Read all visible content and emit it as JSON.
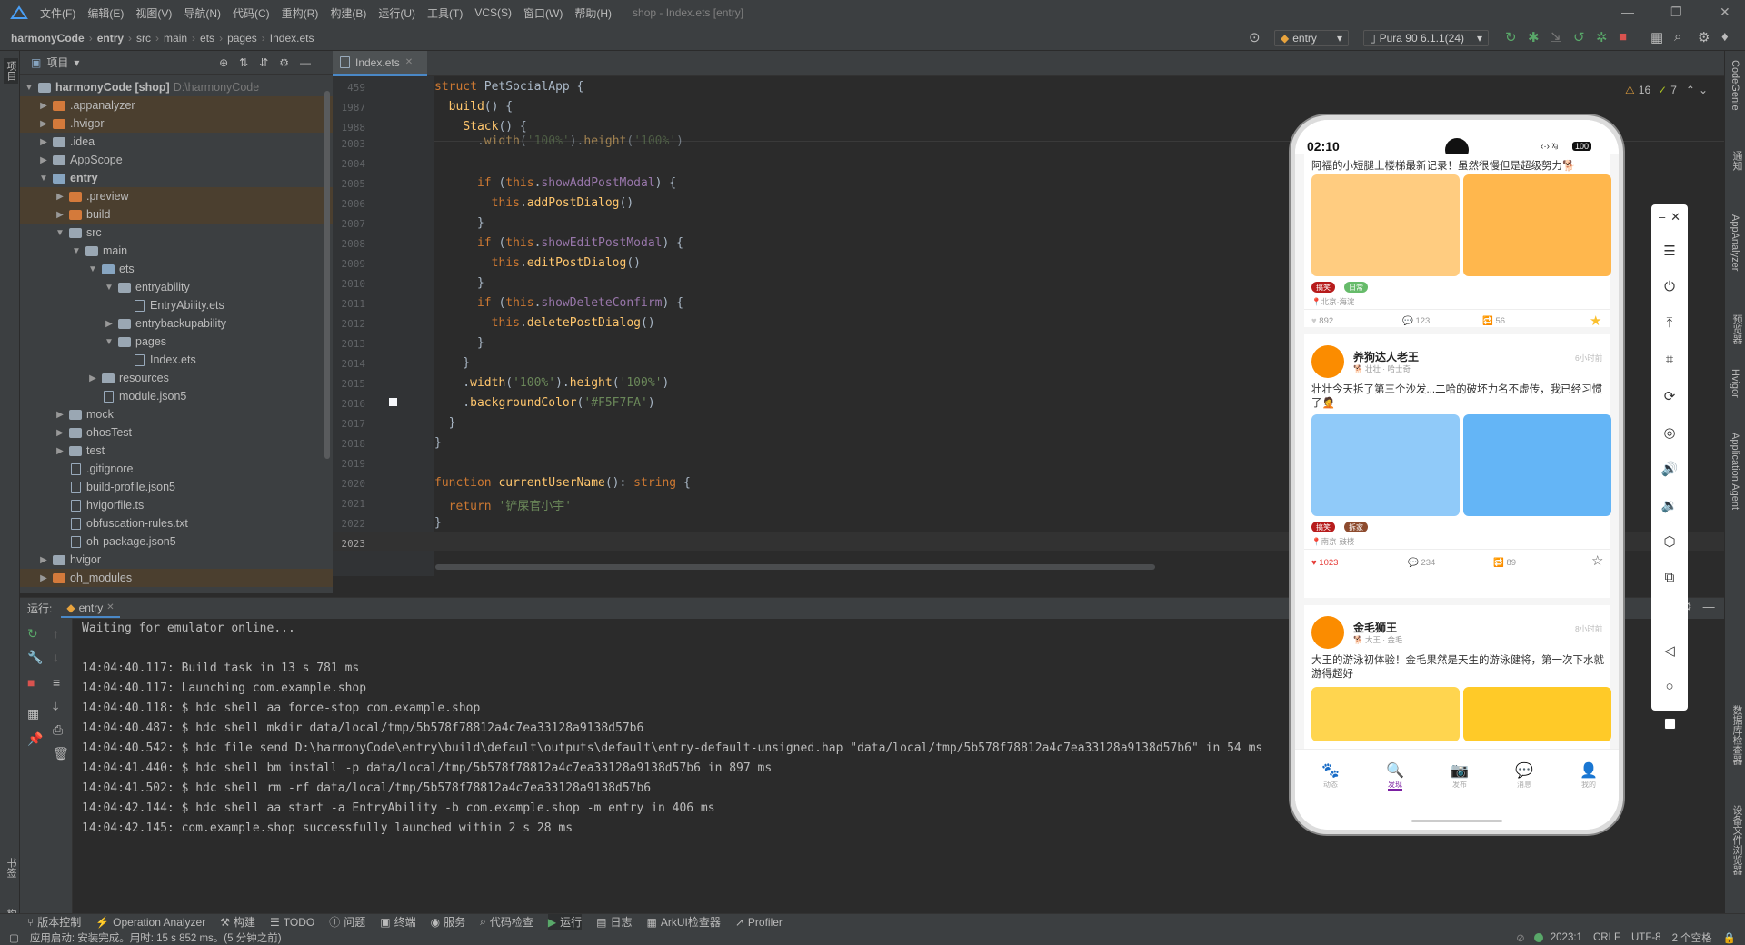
{
  "menu": {
    "items": [
      "文件(F)",
      "编辑(E)",
      "视图(V)",
      "导航(N)",
      "代码(C)",
      "重构(R)",
      "构建(B)",
      "运行(U)",
      "工具(T)",
      "VCS(S)",
      "窗口(W)",
      "帮助(H)"
    ],
    "window_title": "shop - Index.ets [entry]"
  },
  "breadcrumb": [
    "harmonyCode",
    "entry",
    "src",
    "main",
    "ets",
    "pages",
    "Index.ets"
  ],
  "toolbar": {
    "config": "entry",
    "device": "Pura 90 6.1.1(24)"
  },
  "project": {
    "title": "项目",
    "side_label": "项目",
    "rows": [
      {
        "label": "harmonyCode [shop]",
        "extra": "D:\\harmonyCode"
      },
      {
        "label": ".appanalyzer"
      },
      {
        "label": ".hvigor"
      },
      {
        "label": ".idea"
      },
      {
        "label": "AppScope"
      },
      {
        "label": "entry"
      },
      {
        "label": ".preview"
      },
      {
        "label": "build"
      },
      {
        "label": "src"
      },
      {
        "label": "main"
      },
      {
        "label": "ets"
      },
      {
        "label": "entryability"
      },
      {
        "label": "EntryAbility.ets"
      },
      {
        "label": "entrybackupability"
      },
      {
        "label": "pages"
      },
      {
        "label": "Index.ets"
      },
      {
        "label": "resources"
      },
      {
        "label": "module.json5"
      },
      {
        "label": "mock"
      },
      {
        "label": "ohosTest"
      },
      {
        "label": "test"
      },
      {
        "label": ".gitignore"
      },
      {
        "label": "build-profile.json5"
      },
      {
        "label": "hvigorfile.ts"
      },
      {
        "label": "obfuscation-rules.txt"
      },
      {
        "label": "oh-package.json5"
      },
      {
        "label": "hvigor"
      },
      {
        "label": "oh_modules"
      }
    ]
  },
  "editor": {
    "tab": "Index.ets",
    "warnings": "16",
    "weak_warnings": "7",
    "sticky": [
      {
        "num": "459",
        "code": "struct PetSocialApp {"
      },
      {
        "num": "1987",
        "code": "  build() {"
      },
      {
        "num": "1988",
        "code": "    Stack() {"
      }
    ],
    "lines": [
      {
        "num": "2003",
        "code": "      .width('100%').height('100%')"
      },
      {
        "num": "2004",
        "code": ""
      },
      {
        "num": "2005",
        "code": "      if (this.showAddPostModal) {"
      },
      {
        "num": "2006",
        "code": "        this.addPostDialog()"
      },
      {
        "num": "2007",
        "code": "      }"
      },
      {
        "num": "2008",
        "code": "      if (this.showEditPostModal) {"
      },
      {
        "num": "2009",
        "code": "        this.editPostDialog()"
      },
      {
        "num": "2010",
        "code": "      }"
      },
      {
        "num": "2011",
        "code": "      if (this.showDeleteConfirm) {"
      },
      {
        "num": "2012",
        "code": "        this.deletePostDialog()"
      },
      {
        "num": "2013",
        "code": "      }"
      },
      {
        "num": "2014",
        "code": "    }"
      },
      {
        "num": "2015",
        "code": "    .width('100%').height('100%')"
      },
      {
        "num": "2016",
        "code": "    .backgroundColor('#F5F7FA')"
      },
      {
        "num": "2017",
        "code": "  }"
      },
      {
        "num": "2018",
        "code": "}"
      },
      {
        "num": "2019",
        "code": ""
      },
      {
        "num": "2020",
        "code": "function currentUserName(): string {"
      },
      {
        "num": "2021",
        "code": "  return '铲屎官小宇'"
      },
      {
        "num": "2022",
        "code": "}"
      },
      {
        "num": "2023",
        "code": ""
      }
    ]
  },
  "run": {
    "label": "运行:",
    "tab": "entry",
    "lines": [
      "Waiting for emulator online...",
      "",
      "14:04:40.117: Build task in 13 s 781 ms",
      "14:04:40.117: Launching com.example.shop",
      "14:04:40.118: $ hdc shell aa force-stop com.example.shop",
      "14:04:40.487: $ hdc shell mkdir data/local/tmp/5b578f78812a4c7ea33128a9138d57b6",
      "14:04:40.542: $ hdc file send D:\\harmonyCode\\entry\\build\\default\\outputs\\default\\entry-default-unsigned.hap \"data/local/tmp/5b578f78812a4c7ea33128a9138d57b6\" in 54 ms",
      "14:04:41.440: $ hdc shell bm install -p data/local/tmp/5b578f78812a4c7ea33128a9138d57b6 in 897 ms",
      "14:04:41.502: $ hdc shell rm -rf data/local/tmp/5b578f78812a4c7ea33128a9138d57b6",
      "14:04:42.144: $ hdc shell aa start -a EntryAbility -b com.example.shop -m entry in 406 ms",
      "14:04:42.145: com.example.shop successfully launched within 2 s 28 ms"
    ]
  },
  "toolwindows": [
    "版本控制",
    "Operation Analyzer",
    "构建",
    "TODO",
    "问题",
    "终端",
    "服务",
    "代码检查",
    "运行",
    "日志",
    "ArkUI检查器",
    "Profiler"
  ],
  "status": {
    "message": "应用启动: 安装完成。用时: 15 s 852 ms。(5 分钟之前)",
    "position": "2023:1",
    "line_sep": "CRLF",
    "encoding": "UTF-8",
    "indent": "2 个空格"
  },
  "right_tools": [
    "CodeGenie",
    "通知",
    "AppAnalyzer",
    "预览器",
    "Hvigor",
    "Application Agent",
    "数据库检查器",
    "设备文件浏览器"
  ],
  "left_tools": [
    "书签",
    "结构"
  ],
  "phone": {
    "time": "02:10",
    "battery": "100",
    "posts": [
      {
        "text": "阿福的小短腿上楼梯最新记录！虽然很慢但是超级努力🐕",
        "tags": [
          "搞笑",
          "日常"
        ],
        "location": "北京·海淀",
        "likes": "892",
        "comments": "123",
        "shares": "56",
        "colors": [
          "#ffcc80",
          "#ffb74d"
        ]
      },
      {
        "user": "养狗达人老王",
        "pets": "🐕 壮壮 · 哈士奇",
        "time": "6小时前",
        "text": "壮壮今天拆了第三个沙发...二哈的破坏力名不虚传，我已经习惯了🤦",
        "tags": [
          "搞笑",
          "拆家"
        ],
        "location": "南京·鼓楼",
        "likes": "1023",
        "comments": "234",
        "shares": "89",
        "colors": [
          "#90caf9",
          "#64b5f6"
        ]
      },
      {
        "user": "金毛狮王",
        "pets": "🐕 大王 · 金毛",
        "time": "8小时前",
        "text": "大王的游泳初体验！金毛果然是天生的游泳健将，第一次下水就游得超好",
        "colors": [
          "#ffd54f",
          "#ffca28"
        ]
      }
    ],
    "nav": [
      "动态",
      "发现",
      "发布",
      "消息",
      "我的"
    ]
  }
}
